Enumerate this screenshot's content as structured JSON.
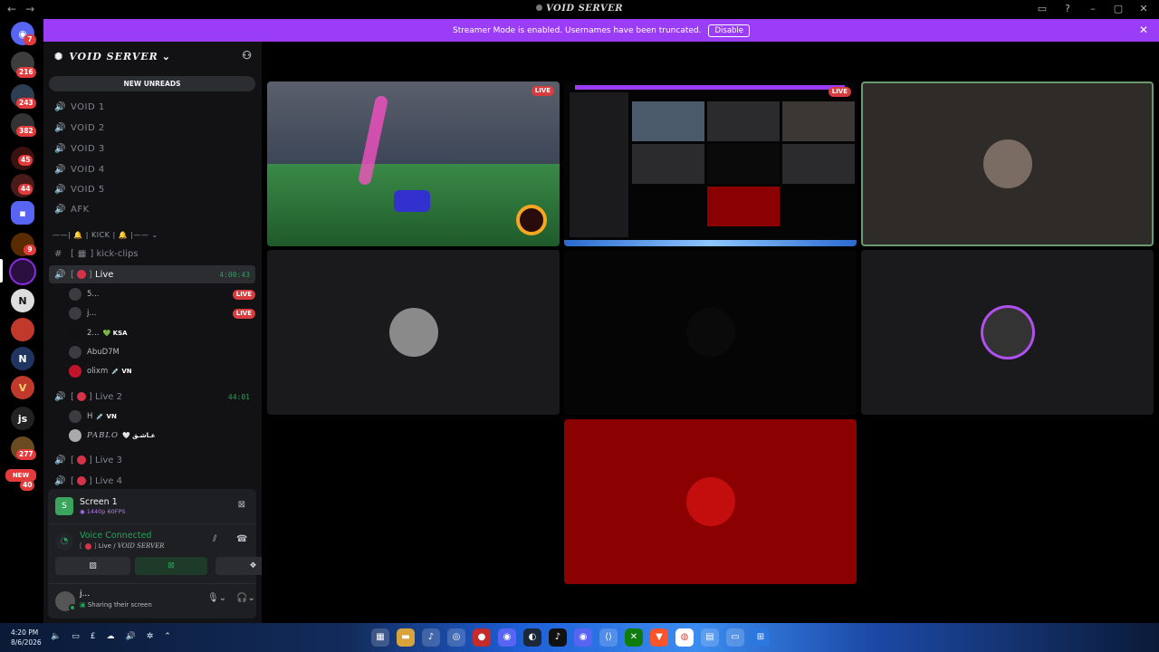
{
  "window": {
    "title": "VOID SERVER"
  },
  "rail": {
    "servers": [
      {
        "label": "",
        "badge": "7"
      },
      {
        "label": "",
        "badge": "216"
      },
      {
        "label": "",
        "badge": "243"
      },
      {
        "label": "",
        "badge": "382"
      },
      {
        "label": "",
        "badge": "45"
      },
      {
        "label": "",
        "badge": "44"
      },
      {
        "label": "",
        "badge": ""
      },
      {
        "label": "",
        "badge": "9"
      },
      {
        "label": "",
        "badge": ""
      },
      {
        "label": "",
        "badge": ""
      },
      {
        "label": "",
        "badge": ""
      },
      {
        "label": "",
        "badge": ""
      },
      {
        "label": "",
        "badge": ""
      },
      {
        "label": "js",
        "badge": ""
      },
      {
        "label": "",
        "badge": "277"
      }
    ],
    "new_label": "NEW",
    "new_badge_count": "40"
  },
  "banner": {
    "text": "Streamer Mode is enabled. Usernames have been truncated.",
    "button": "Disable"
  },
  "sidebar": {
    "server_name": "VOID SERVER",
    "new_unreads": "NEW UNREADS",
    "voice_channels": [
      "VOID 1",
      "VOID 2",
      "VOID 3",
      "VOID 4",
      "VOID 5",
      "AFK"
    ],
    "category": "——| 🔔 | KICK | 🔔 |——",
    "text_channel": "kick-clips",
    "live_channel": {
      "name": "Live",
      "timer": "4:00:43"
    },
    "live_users": [
      {
        "name": "5...",
        "tag": "",
        "live": "LIVE"
      },
      {
        "name": "j...",
        "tag": "",
        "live": "LIVE"
      },
      {
        "name": "2...",
        "tag": "💚 KSA",
        "live": ""
      },
      {
        "name": "AbuD7M",
        "tag": "",
        "live": ""
      },
      {
        "name": "olixm",
        "tag": "💉 VN",
        "live": ""
      }
    ],
    "live2_channel": {
      "name": "Live 2",
      "timer": "44:01"
    },
    "live2_users": [
      {
        "name": "H",
        "tag": "💉 VN"
      },
      {
        "name": "PABLO",
        "tag": "🤍 عـاشـق"
      }
    ],
    "more_channels": [
      "Live 3",
      "Live 4"
    ]
  },
  "panel": {
    "screen_title": "Screen 1",
    "screen_quality": "1440p 60FPS",
    "voice_status": "Voice Connected",
    "voice_channel": "Live",
    "voice_server": "VOID SERVER",
    "user_name": "j...",
    "user_status": "Sharing their screen"
  },
  "stage": {
    "live_label": "LIVE"
  },
  "taskbar": {
    "time": "4:20 PM",
    "date": "8/6/2026"
  },
  "colors": {
    "accent": "#9b3df6",
    "online": "#23a559",
    "live": "#d83c3e"
  }
}
